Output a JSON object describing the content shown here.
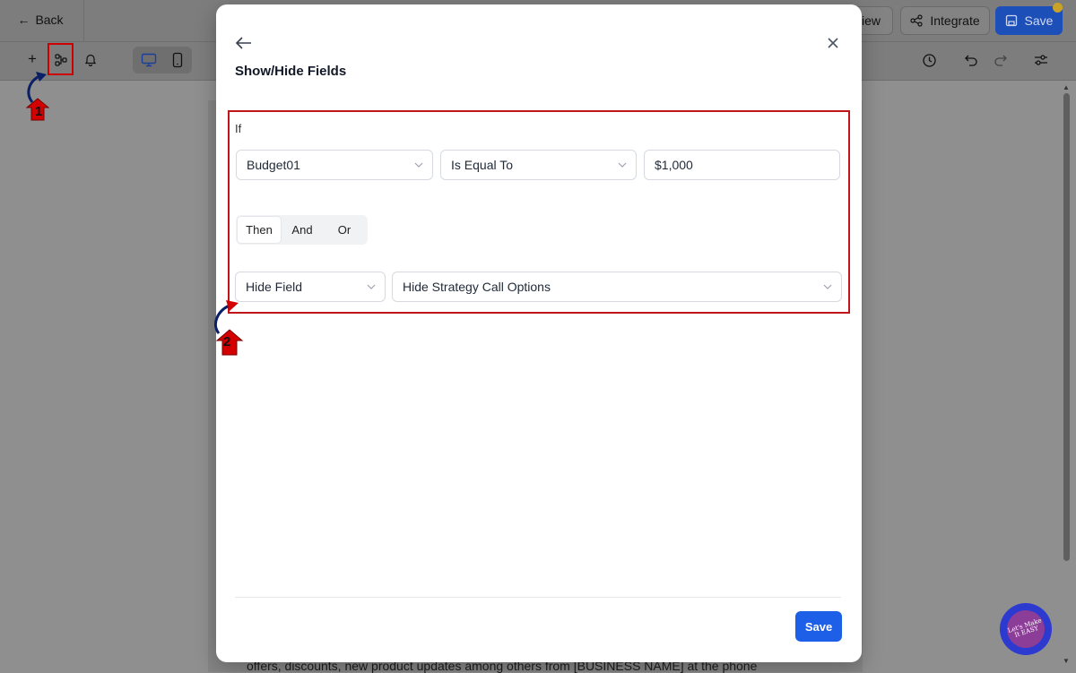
{
  "header": {
    "back_label": "Back",
    "preview_label": "view",
    "integrate_label": "Integrate",
    "save_label": "Save"
  },
  "modal": {
    "title": "Show/Hide Fields",
    "if_label": "If",
    "condition": {
      "field_value": "Budget01",
      "operator_value": "Is Equal To",
      "value": "$1,000"
    },
    "logic_buttons": [
      {
        "label": "Then",
        "active": true
      },
      {
        "label": "And",
        "active": false
      },
      {
        "label": "Or",
        "active": false
      }
    ],
    "action": {
      "action_value": "Hide Field",
      "target_value": "Hide Strategy Call Options"
    },
    "save_label": "Save"
  },
  "canvas": {
    "text": "offers, discounts, new product updates among others from [BUSINESS NAME] at the phone"
  },
  "annotations": {
    "step1": "1",
    "step2": "2"
  },
  "badge": {
    "text": "Let's Make It EASY"
  },
  "colors": {
    "primary": "#1d5fe6",
    "annotation_red": "#c0161b",
    "arrow_navy": "#0b1f66"
  }
}
